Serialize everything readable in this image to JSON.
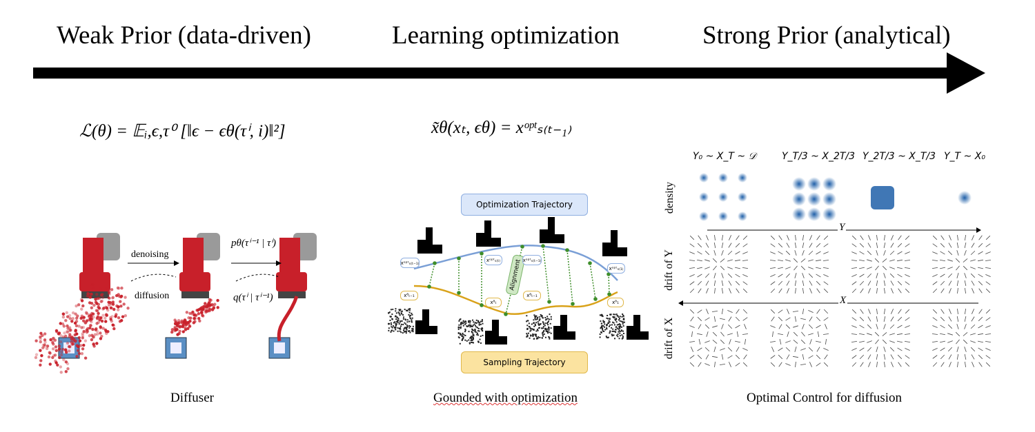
{
  "headings": {
    "left": "Weak Prior (data-driven)",
    "center": "Learning optimization",
    "right": "Strong Prior (analytical)"
  },
  "diffuser": {
    "equation": "ℒ(θ) = 𝔼ᵢ,ϵ,τ⁰ [‖ϵ − ϵθ(τⁱ, i)‖²]",
    "forward_label": "denoising",
    "backward_label": "diffusion",
    "p_label": "pθ(τⁱ⁻¹ | τⁱ)",
    "q_label": "q(τⁱ | τⁱ⁻¹)",
    "caption": "Diffuser",
    "colors": {
      "robot": "#c8202a",
      "box": "#5b8fc4",
      "dots": "#c8202a"
    }
  },
  "optimization": {
    "equation": "x̃θ(xₜ, ϵθ) = xᵒᵖᵗₛ₍ₜ₋₁₎",
    "top_box": "Optimization Trajectory",
    "bottom_box": "Sampling Trajectory",
    "alignment_label": "Alignment",
    "opt_labels": [
      "xᵒᵖᵗₛ₍ₜ₋₁₎",
      "xᵒᵖᵗₛ₍ₜ₎",
      "xᵒᵖᵗₛ₍ₜ₋₁₎",
      "xᵒᵖᵗₛ₍₁₎"
    ],
    "samp_labels": [
      "xᶿₜ₋₁",
      "xᶿₜ",
      "xᶿₜ₋₁",
      "xᶿ₁"
    ],
    "caption": "Gounded with optimization",
    "colors": {
      "opt_curve": "#7a9fd6",
      "samp_curve": "#d9a21a",
      "alignment": "#3e8e2a"
    }
  },
  "optimal_control": {
    "column_labels": [
      "Y₀ ~ X_T ~ 𝒟",
      "Y_T/3 ~ X_2T/3",
      "Y_2T/3 ~ X_T/3",
      "Y_T ~ X₀"
    ],
    "row_labels": [
      "density",
      "drift of Y",
      "drift of X"
    ],
    "axis_Y": "Y",
    "axis_X": "X",
    "caption": "Optimal Control for diffusion",
    "colors": {
      "density": "#1f5fa8"
    }
  },
  "arrow_color": "#000000"
}
